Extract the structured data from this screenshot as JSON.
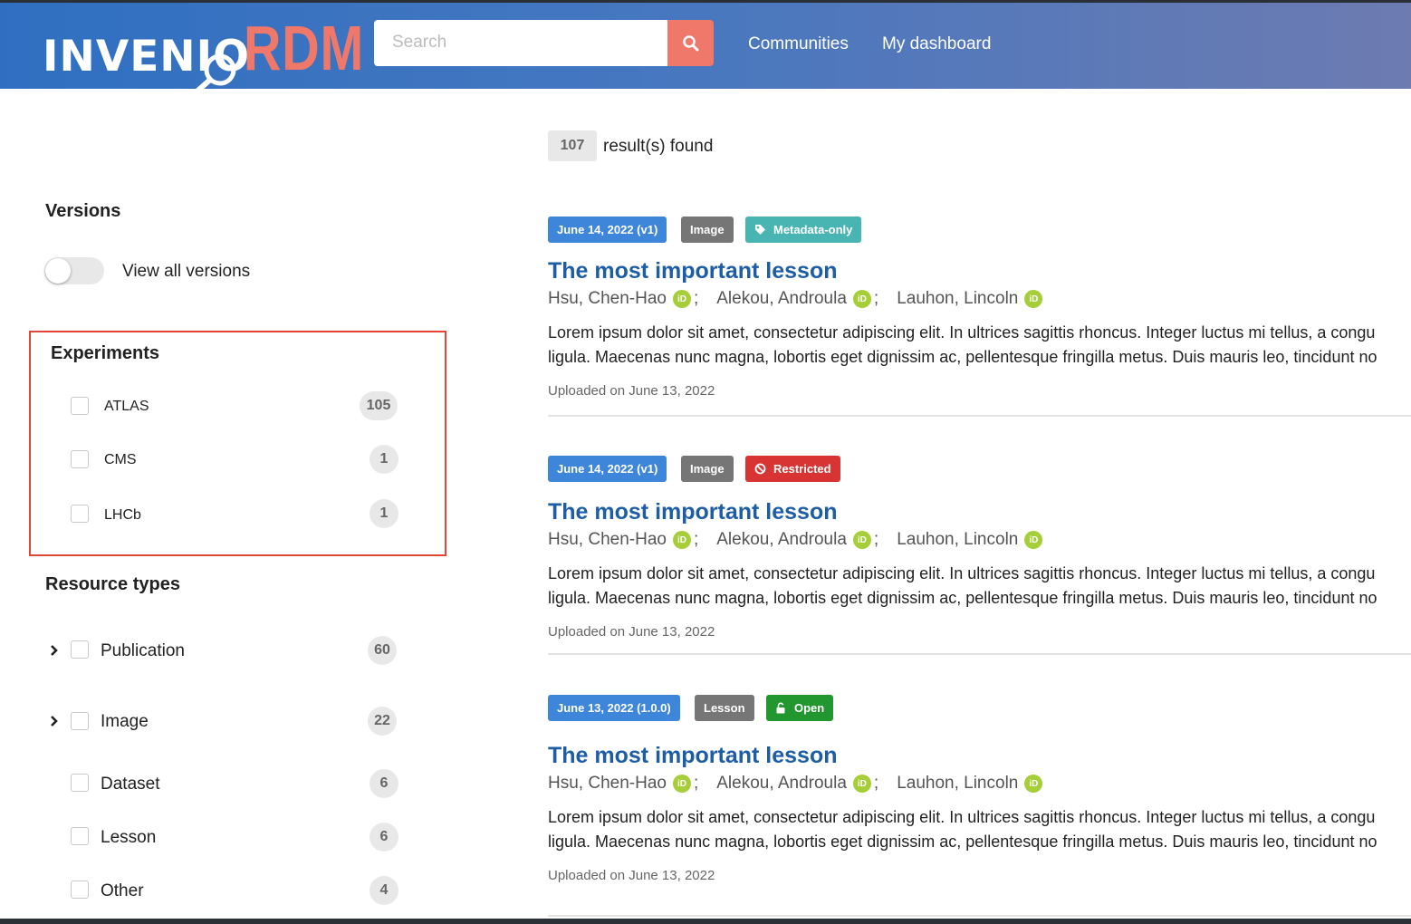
{
  "header": {
    "logo_main": "INVENIO",
    "logo_accent": "RDM",
    "search_placeholder": "Search",
    "nav": [
      "Communities",
      "My dashboard"
    ],
    "brand_accent_color": "#f0786a"
  },
  "results": {
    "count": "107",
    "found_label": "result(s) found"
  },
  "facets": {
    "versions": {
      "title": "Versions",
      "toggle_label": "View all versions",
      "toggle_on": false
    },
    "experiments": {
      "title": "Experiments",
      "items": [
        {
          "label": "ATLAS",
          "count": "105"
        },
        {
          "label": "CMS",
          "count": "1"
        },
        {
          "label": "LHCb",
          "count": "1"
        }
      ]
    },
    "resource_types": {
      "title": "Resource types",
      "items": [
        {
          "label": "Publication",
          "count": "60",
          "expandable": true
        },
        {
          "label": "Image",
          "count": "22",
          "expandable": true
        },
        {
          "label": "Dataset",
          "count": "6",
          "expandable": false
        },
        {
          "label": "Lesson",
          "count": "6",
          "expandable": false
        },
        {
          "label": "Other",
          "count": "4",
          "expandable": false
        }
      ]
    }
  },
  "records": [
    {
      "date_label": "June 14, 2022 (v1)",
      "type_label": "Image",
      "access_label": "Metadata-only",
      "access_icon": "tag-icon",
      "access_color": "#48b5b2",
      "title": "The most important lesson",
      "creators": [
        "Hsu, Chen-Hao",
        "Alekou, Androula",
        "Lauhon, Lincoln"
      ],
      "description": [
        "Lorem ipsum dolor sit amet, consectetur adipiscing elit. In ultrices sagittis rhoncus. Integer luctus mi tellus, a congu",
        "ligula. Maecenas nunc magna, lobortis eget dignissim ac, pellentesque fringilla metus. Duis mauris leo, tincidunt no"
      ],
      "uploaded": "Uploaded on June 13, 2022"
    },
    {
      "date_label": "June 14, 2022 (v1)",
      "type_label": "Image",
      "access_label": "Restricted",
      "access_icon": "ban-icon",
      "access_color": "#d93434",
      "title": "The most important lesson",
      "creators": [
        "Hsu, Chen-Hao",
        "Alekou, Androula",
        "Lauhon, Lincoln"
      ],
      "description": [
        "Lorem ipsum dolor sit amet, consectetur adipiscing elit. In ultrices sagittis rhoncus. Integer luctus mi tellus, a congu",
        "ligula. Maecenas nunc magna, lobortis eget dignissim ac, pellentesque fringilla metus. Duis mauris leo, tincidunt no"
      ],
      "uploaded": "Uploaded on June 13, 2022"
    },
    {
      "date_label": "June 13, 2022 (1.0.0)",
      "type_label": "Lesson",
      "access_label": "Open",
      "access_icon": "unlock-icon",
      "access_color": "#22962f",
      "title": "The most important lesson",
      "creators": [
        "Hsu, Chen-Hao",
        "Alekou, Androula",
        "Lauhon, Lincoln"
      ],
      "description": [
        "Lorem ipsum dolor sit amet, consectetur adipiscing elit. In ultrices sagittis rhoncus. Integer luctus mi tellus, a congu",
        "ligula. Maecenas nunc magna, lobortis eget dignissim ac, pellentesque fringilla metus. Duis mauris leo, tincidunt no"
      ],
      "uploaded": "Uploaded on June 13, 2022"
    }
  ]
}
